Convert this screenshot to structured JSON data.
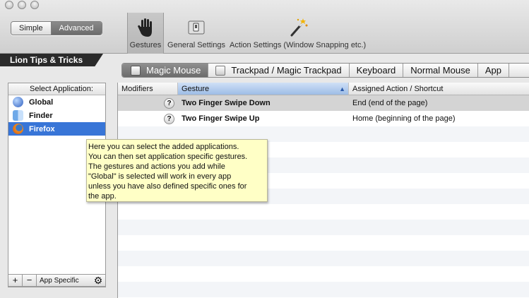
{
  "toolbar": {
    "mode_segment": [
      "Simple",
      "Advanced"
    ],
    "items": [
      {
        "label": "Gestures",
        "icon": "hand-icon"
      },
      {
        "label": "General Settings",
        "icon": "switch-icon"
      },
      {
        "label": "Action Settings (Window Snapping etc.)",
        "icon": "magic-wand-icon"
      }
    ]
  },
  "brand": "Lion Tips & Tricks",
  "apps": {
    "header": "Select Application:",
    "items": [
      {
        "label": "Global",
        "icon": "globe-icon"
      },
      {
        "label": "Finder",
        "icon": "finder-icon"
      },
      {
        "label": "Firefox",
        "icon": "firefox-icon"
      }
    ],
    "footer": {
      "add": "+",
      "remove": "−",
      "mode": "App Specific"
    }
  },
  "tabs": [
    "Magic Mouse",
    "Trackpad / Magic Trackpad",
    "Keyboard",
    "Normal Mouse",
    "App"
  ],
  "table": {
    "columns": [
      "Modifiers",
      "Gesture",
      "Assigned Action / Shortcut"
    ],
    "rows": [
      {
        "gesture": "Two Finger Swipe Down",
        "action": "End (end of the page)"
      },
      {
        "gesture": "Two Finger Swipe Up",
        "action": "Home (beginning of the page)"
      }
    ]
  },
  "tooltip": "Here you can select the added applications.\nYou can then set application specific gestures.\nThe gestures and actions you add while\n\"Global\" is selected will work in every app\nunless you have also defined specific ones for\nthe app.",
  "colors": {
    "selection": "#3875d7",
    "tooltip_bg": "#ffffc6"
  }
}
